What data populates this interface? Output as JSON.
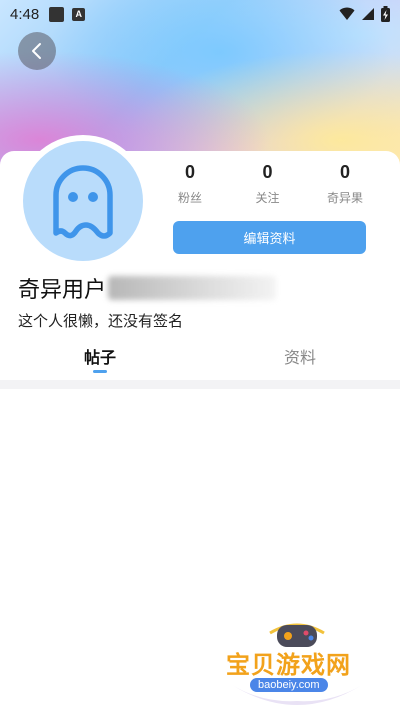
{
  "status_bar": {
    "time": "4:48",
    "app_icon_letter": "A",
    "icons": [
      "wifi-icon",
      "signal-icon",
      "battery-charging-icon"
    ]
  },
  "header": {
    "back_icon": "chevron-left-icon"
  },
  "profile": {
    "avatar_icon": "ghost-icon",
    "username": "奇异用户",
    "signature": "这个人很懒，还没有签名",
    "stats": [
      {
        "value": "0",
        "label": "粉丝"
      },
      {
        "value": "0",
        "label": "关注"
      },
      {
        "value": "0",
        "label": "奇异果"
      }
    ],
    "edit_button_label": "编辑资料"
  },
  "tabs": [
    {
      "label": "帖子",
      "active": true
    },
    {
      "label": "资料",
      "active": false
    }
  ],
  "watermark": {
    "title": "宝贝游戏网",
    "url": "baobeiy.com"
  },
  "colors": {
    "accent": "#4ea1ee",
    "avatar_bg": "#b9dcfb",
    "watermark_orange": "#f2a21b"
  }
}
